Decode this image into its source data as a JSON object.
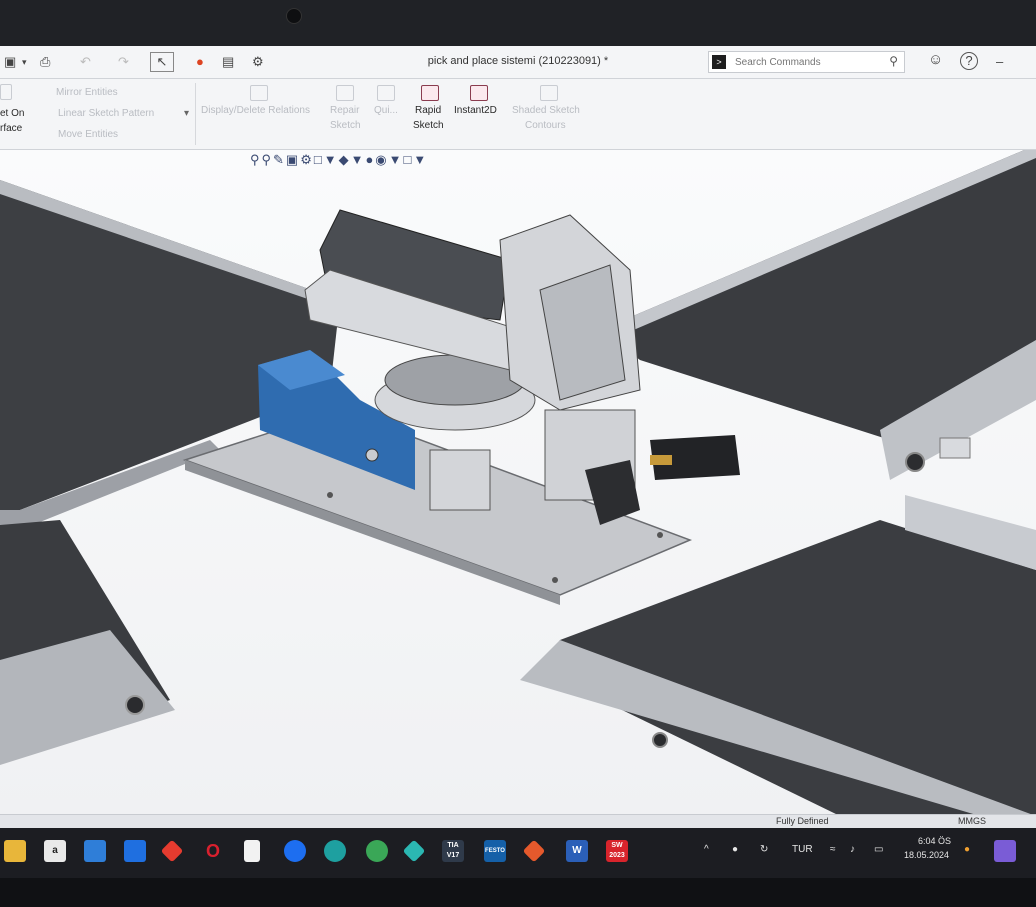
{
  "window": {
    "title": "pick and place sistemi (210223091) *"
  },
  "quick_access": {
    "icons": [
      "save-icon",
      "print-icon",
      "undo-icon",
      "redo-icon",
      "select-icon",
      "traffic-light-icon",
      "file-properties-icon",
      "options-gear-icon"
    ]
  },
  "search": {
    "placeholder": "Search Commands"
  },
  "help": {
    "account_icon": "user-icon",
    "help_icon": "help-icon",
    "minimize": "–"
  },
  "ribbon": {
    "left_group": {
      "set_on_surface_1": "et On",
      "set_on_surface_2": "rface",
      "mirror": "Mirror Entities",
      "linear_pattern": "Linear Sketch Pattern",
      "move": "Move Entities"
    },
    "display_delete_relations": "Display/Delete Relations",
    "repair_sketch_1": "Repair",
    "repair_sketch_2": "Sketch",
    "quick_snaps": "Qui...",
    "rapid_sketch_1": "Rapid",
    "rapid_sketch_2": "Sketch",
    "instant2d": "Instant2D",
    "shaded_contours_1": "Shaded Sketch",
    "shaded_contours_2": "Contours"
  },
  "statusbar": {
    "status": "Fully Defined",
    "units": "MMGS"
  },
  "taskbar": {
    "apps": [
      {
        "name": "file-explorer-icon",
        "label": "",
        "color": "#e8b63a"
      },
      {
        "name": "notepad-a-icon",
        "label": "a",
        "color": "#e9e9e9"
      },
      {
        "name": "mail-icon",
        "label": "",
        "color": "#2f7ed8"
      },
      {
        "name": "dropbox-icon",
        "label": "",
        "color": "#1f6fe0"
      },
      {
        "name": "red-diamond-icon",
        "label": "",
        "color": "#e53b2f"
      },
      {
        "name": "opera-icon",
        "label": "O",
        "color": "#d9202e"
      },
      {
        "name": "document-icon",
        "label": "",
        "color": "#f2f2f2"
      },
      {
        "name": "teamviewer-icon",
        "label": "",
        "color": "#1d6ef0"
      },
      {
        "name": "edge-icon",
        "label": "",
        "color": "#1ea0a0"
      },
      {
        "name": "chrome-icon",
        "label": "",
        "color": "#3aa757"
      },
      {
        "name": "diamond-app-icon",
        "label": "",
        "color": "#2bb7b2"
      },
      {
        "name": "tia-portal-icon",
        "label": "TIA V17",
        "color": "#2f3a4a"
      },
      {
        "name": "festo-icon",
        "label": "FESTO",
        "color": "#1560a8"
      },
      {
        "name": "matlab-icon",
        "label": "",
        "color": "#e5592c"
      },
      {
        "name": "word-icon",
        "label": "W",
        "color": "#2b5fb8"
      },
      {
        "name": "solidworks-icon",
        "label": "SW 2023",
        "color": "#d8242c"
      }
    ],
    "tray": {
      "language": "TUR",
      "time": "6:04 ÖS",
      "date": "18.05.2024"
    }
  }
}
